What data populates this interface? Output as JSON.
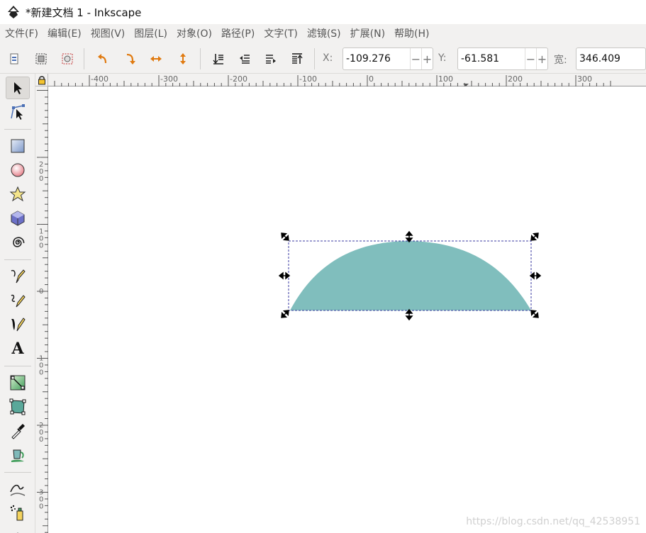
{
  "window": {
    "title": "*新建文档 1 - Inkscape",
    "app_icon": "inkscape-logo-icon"
  },
  "menubar": {
    "items": [
      {
        "label": "文件(F)"
      },
      {
        "label": "编辑(E)"
      },
      {
        "label": "视图(V)"
      },
      {
        "label": "图层(L)"
      },
      {
        "label": "对象(O)"
      },
      {
        "label": "路径(P)"
      },
      {
        "label": "文字(T)"
      },
      {
        "label": "滤镜(S)"
      },
      {
        "label": "扩展(N)"
      },
      {
        "label": "帮助(H)"
      }
    ]
  },
  "controls": {
    "x_label": "X:",
    "x_value": "-109.276",
    "y_label": "Y:",
    "y_value": "-61.581",
    "w_label": "宽:",
    "w_value": "346.409",
    "minus": "−",
    "plus": "+"
  },
  "toolbox": {
    "tools": [
      "selector-arrow-icon",
      "node-editor-icon",
      "rectangle-icon",
      "ellipse-icon",
      "star-icon",
      "3d-box-icon",
      "spiral-icon",
      "pen-icon",
      "pencil-icon",
      "calligraphy-icon",
      "text-icon",
      "gradient-icon",
      "mesh-icon",
      "dropper-icon",
      "paint-bucket-icon",
      "tweak-icon",
      "spray-icon",
      "eraser-icon"
    ],
    "text_tool_glyph": "A"
  },
  "rulers": {
    "horizontal_labels": [
      "-400",
      "-300",
      "-200",
      "-100",
      "0",
      "100",
      "200",
      "300"
    ],
    "vertical_labels": [
      "-200",
      "-100",
      "0",
      "100",
      "200",
      "300"
    ]
  },
  "canvas": {
    "shape": "half-ellipse",
    "fill_color": "#80bebd",
    "selection_color": "#3a3aa0"
  },
  "watermark": "https://blog.csdn.net/qq_42538951"
}
